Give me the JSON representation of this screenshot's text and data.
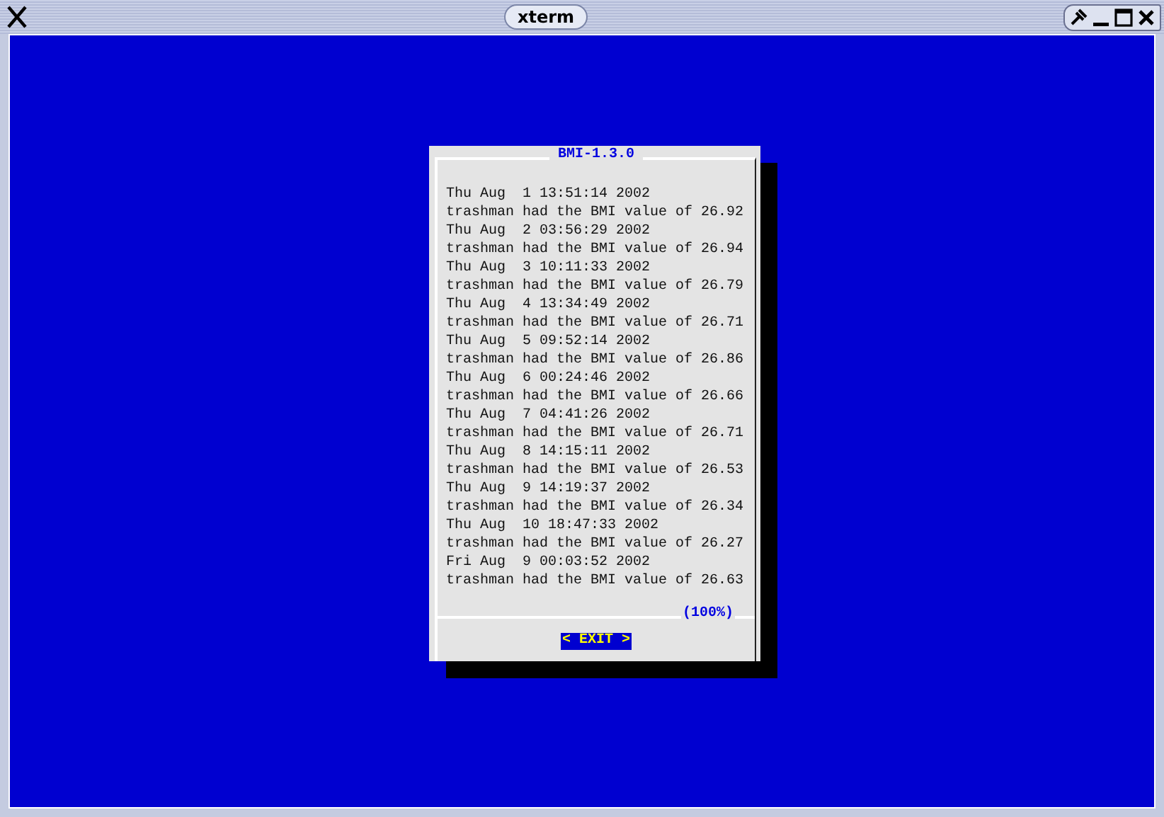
{
  "window": {
    "title": "xterm"
  },
  "dialog": {
    "title": "BMI-1.3.0",
    "lines": [
      "Thu Aug  1 13:51:14 2002",
      "trashman had the BMI value of 26.92",
      "Thu Aug  2 03:56:29 2002",
      "trashman had the BMI value of 26.94",
      "Thu Aug  3 10:11:33 2002",
      "trashman had the BMI value of 26.79",
      "Thu Aug  4 13:34:49 2002",
      "trashman had the BMI value of 26.71",
      "Thu Aug  5 09:52:14 2002",
      "trashman had the BMI value of 26.86",
      "Thu Aug  6 00:24:46 2002",
      "trashman had the BMI value of 26.66",
      "Thu Aug  7 04:41:26 2002",
      "trashman had the BMI value of 26.71",
      "Thu Aug  8 14:15:11 2002",
      "trashman had the BMI value of 26.53",
      "Thu Aug  9 14:19:37 2002",
      "trashman had the BMI value of 26.34",
      "Thu Aug  10 18:47:33 2002",
      "trashman had the BMI value of 26.27",
      "Fri Aug  9 00:03:52 2002",
      "trashman had the BMI value of 26.63"
    ],
    "scroll_percent": "(100%)",
    "button": {
      "label": "< EXIT >",
      "selected": true
    }
  }
}
